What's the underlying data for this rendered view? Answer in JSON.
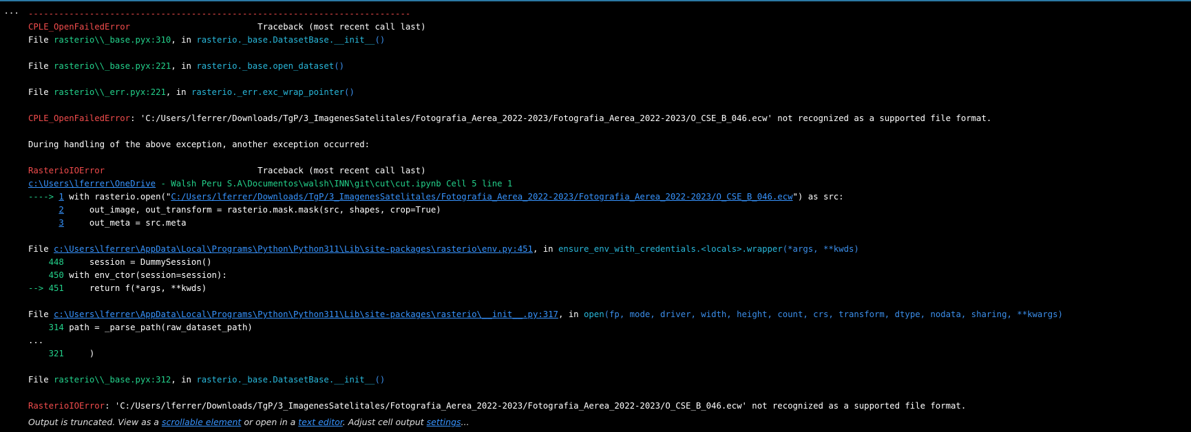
{
  "cell": {
    "collapse_glyph": "..."
  },
  "tb1": {
    "rule": "---------------------------------------------------------------------------",
    "error": "CPLE_OpenFailedError",
    "gap": "                         ",
    "heading": "Traceback (most recent call last)",
    "frames": [
      {
        "file": "rasterio\\\\_base.pyx:310",
        "func": "rasterio._base.DatasetBase.__init__",
        "args": "()"
      },
      {
        "file": "rasterio\\\\_base.pyx:221",
        "func": "rasterio._base.open_dataset",
        "args": "()"
      },
      {
        "file": "rasterio\\\\_err.pyx:221",
        "func": "rasterio._err.exc_wrap_pointer",
        "args": "()"
      }
    ],
    "final_error": "CPLE_OpenFailedError",
    "message": ": 'C:/Users/lferrer/Downloads/TgP/3_ImagenesSatelitales/Fotografia_Aerea_2022-2023/Fotografia_Aerea_2022-2023/O_CSE_B_046.ecw' not recognized as a supported file format."
  },
  "during": "During handling of the above exception, another exception occurred:",
  "tb2": {
    "error": "RasterioIOError",
    "gap": "                              ",
    "heading": "Traceback (most recent call last)",
    "cell_link": "c:\\Users\\lferrer\\OneDrive",
    "cell_path": " - Walsh Peru S.A\\Documentos\\walsh\\INN\\git\\cut\\cut.ipynb Cell 5 line 1",
    "cell_line": "1",
    "code": {
      "arrow": "----> ",
      "l1_num": "1",
      "l1_pre": " with rasterio.open(\"",
      "l1_link": "C:/Users/lferrer/Downloads/TgP/3_ImagenesSatelitales/Fotografia_Aerea_2022-2023/Fotografia_Aerea_2022-2023/O_CSE_B_046.ecw",
      "l1_post": "\") as src:",
      "l2_num": "2",
      "l2_code": "     out_image, out_transform = rasterio.mask.mask(src, shapes, crop=True)",
      "l3_num": "3",
      "l3_code": "     out_meta = src.meta"
    },
    "env_frame": {
      "prefix": "File ",
      "link": "c:\\Users\\lferrer\\AppData\\Local\\Programs\\Python\\Python311\\Lib\\site-packages\\rasterio\\env.py:451",
      "mid": ", in ",
      "func": "ensure_env_with_credentials.<locals>.wrapper",
      "args": "(*args, **kwds)",
      "lines": [
        {
          "num": "    448",
          "code": "     session = DummySession()"
        },
        {
          "num": "    450",
          "code": " with env_ctor(session=session):"
        },
        {
          "num": "--> 451",
          "code": "     return f(*args, **kwds)"
        }
      ]
    },
    "init_frame": {
      "prefix": "File ",
      "link": "c:\\Users\\lferrer\\AppData\\Local\\Programs\\Python\\Python311\\Lib\\site-packages\\rasterio\\__init__.py:317",
      "mid": ", in ",
      "func": "open",
      "args": "(fp, mode, driver, width, height, count, crs, transform, dtype, nodata, sharing, **kwargs)",
      "l1_num": "    314",
      "l1_code": " path = _parse_path(raw_dataset_path)",
      "dots": "...",
      "l2_num": "    321",
      "l2_code": "     )"
    },
    "base_frame": {
      "prefix": "File ",
      "file": "rasterio\\\\_base.pyx:312",
      "mid": ", in ",
      "func": "rasterio._base.DatasetBase.__init__",
      "args": "()"
    },
    "final_error": "RasterioIOError",
    "message": ": 'C:/Users/lferrer/Downloads/TgP/3_ImagenesSatelitales/Fotografia_Aerea_2022-2023/Fotografia_Aerea_2022-2023/O_CSE_B_046.ecw' not recognized as a supported file format."
  },
  "footer": {
    "t1": "Output is truncated. View as a ",
    "link1": "scrollable element",
    "t2": " or open in a ",
    "link2": "text editor",
    "t3": ". Adjust cell output ",
    "link3": "settings",
    "t4": "..."
  },
  "labels": {
    "file": "File ",
    "in": ", in "
  },
  "colors": {
    "background": "#000000",
    "error_red": "#f14c4c",
    "file_green": "#23d18b",
    "func_cyan": "#29b8db",
    "args_blue": "#3b8eea",
    "link_blue": "#3794ff",
    "top_border": "#2b79a5"
  }
}
